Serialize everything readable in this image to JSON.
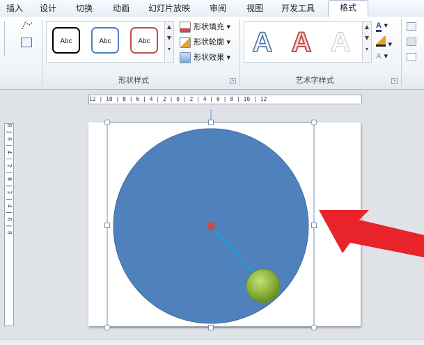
{
  "tabs": [
    "插入",
    "设计",
    "切换",
    "动画",
    "幻灯片放映",
    "审阅",
    "视图",
    "开发工具",
    "格式"
  ],
  "active_tab": "格式",
  "ribbon": {
    "shape_styles": {
      "label": "形状样式",
      "style_samples": [
        "Abc",
        "Abc",
        "Abc"
      ],
      "fill": "形状填充",
      "outline": "形状轮廓",
      "effects": "形状效果"
    },
    "wordart_styles": {
      "label": "艺术字样式",
      "samples": [
        "A",
        "A",
        "A"
      ]
    }
  },
  "rulers": {
    "horizontal": "12 | 10 | 8 | 6 | 4 | 2 | 0 | 2 | 4 | 6 | 8 | 10 | 12",
    "vertical": "8 | 6 | 4 | 2 | 0 | 2 | 4 | 6 | 8"
  },
  "colors": {
    "circle": "#4f81bd",
    "circle_stroke": "#3f6a9e",
    "center_dot": "#c0504d",
    "line": "#1f9bd6",
    "small_ball": "#8db33a",
    "arrow": "#e8242a",
    "style1": "#000000",
    "style2": "#4f81bd",
    "style3": "#c0504d"
  }
}
